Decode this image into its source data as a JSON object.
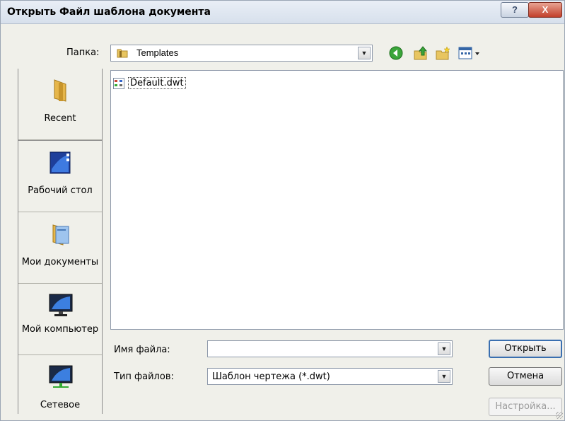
{
  "window": {
    "title": "Открыть Файл шаблона документа",
    "help_glyph": "?",
    "close_glyph": "X"
  },
  "folder": {
    "label": "Папка:",
    "value": "Templates",
    "icon": "folder-icon"
  },
  "toolbar": {
    "icons": [
      "back-icon",
      "up-folder-icon",
      "new-folder-icon",
      "views-menu-icon"
    ]
  },
  "places": [
    {
      "label": "Recent",
      "icon": "recent-folder-icon"
    },
    {
      "label": "Рабочий стол",
      "icon": "desktop-icon"
    },
    {
      "label": "Мои документы",
      "icon": "my-documents-icon"
    },
    {
      "label": "Мой компьютер",
      "icon": "my-computer-icon"
    },
    {
      "label": "Сетевое",
      "icon": "network-icon"
    }
  ],
  "files": [
    {
      "name": "Default.dwt",
      "icon": "dwt-file-icon"
    }
  ],
  "filename": {
    "label": "Имя файла:",
    "value": ""
  },
  "filetype": {
    "label": "Тип файлов:",
    "value": "Шаблон чертежа (*.dwt)"
  },
  "buttons": {
    "open": "Открыть",
    "cancel": "Отмена",
    "settings": "Настройка..."
  },
  "colors": {
    "dialog_bg": "#f0f0ea",
    "title_bg": "#dde5f0",
    "close_red": "#c2402b"
  }
}
